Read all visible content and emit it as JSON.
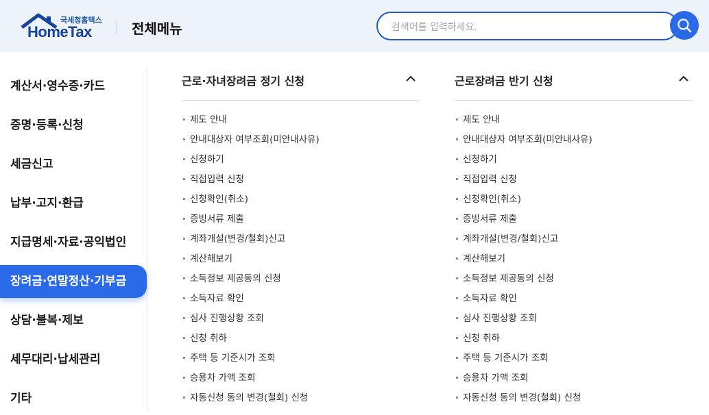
{
  "header": {
    "logo_sub": "국세청홈택스",
    "logo_main": "HomeTax",
    "menu_title": "전체메뉴",
    "search_placeholder": "검색어를 입력하세요.",
    "search_value": "",
    "search_icon": "search-icon"
  },
  "colors": {
    "accent": "#2a6ae8",
    "header_bg": "#eef2f9",
    "logo": "#16459a"
  },
  "sidebar": {
    "active_index": 5,
    "items": [
      {
        "label": "계산서·영수증·카드"
      },
      {
        "label": "증명·등록·신청"
      },
      {
        "label": "세금신고"
      },
      {
        "label": "납부·고지·환급"
      },
      {
        "label": "지급명세·자료·공익법인"
      },
      {
        "label": "장려금·연말정산·기부금"
      },
      {
        "label": "상담·불복·제보"
      },
      {
        "label": "세무대리·납세관리"
      },
      {
        "label": "기타"
      }
    ]
  },
  "columns": [
    {
      "title": "근로·자녀장려금 정기 신청",
      "toggle_icon": "chevron-up-icon",
      "links": [
        "제도 안내",
        "안내대상자 여부조회(미안내사유)",
        "신청하기",
        "직접입력 신청",
        "신청확인(취소)",
        "증빙서류 제출",
        "계좌개설(변경/철회)신고",
        "계산해보기",
        "소득정보 제공동의 신청",
        "소득자료 확인",
        "심사 진행상황 조회",
        "신청 취하",
        "주택 등 기준시가 조회",
        "승용차 가액 조회",
        "자동신청 동의 변경(철회) 신청"
      ]
    },
    {
      "title": "근로장려금 반기 신청",
      "toggle_icon": "chevron-up-icon",
      "links": [
        "제도 안내",
        "안내대상자 여부조회(미안내사유)",
        "신청하기",
        "직접입력 신청",
        "신청확인(취소)",
        "증빙서류 제출",
        "계좌개설(변경/철회)신고",
        "계산해보기",
        "소득정보 제공동의 신청",
        "소득자료 확인",
        "심사 진행상황 조회",
        "신청 취하",
        "주택 등 기준시가 조회",
        "승용차 가액 조회",
        "자동신청 동의 변경(철회) 신청"
      ]
    }
  ]
}
